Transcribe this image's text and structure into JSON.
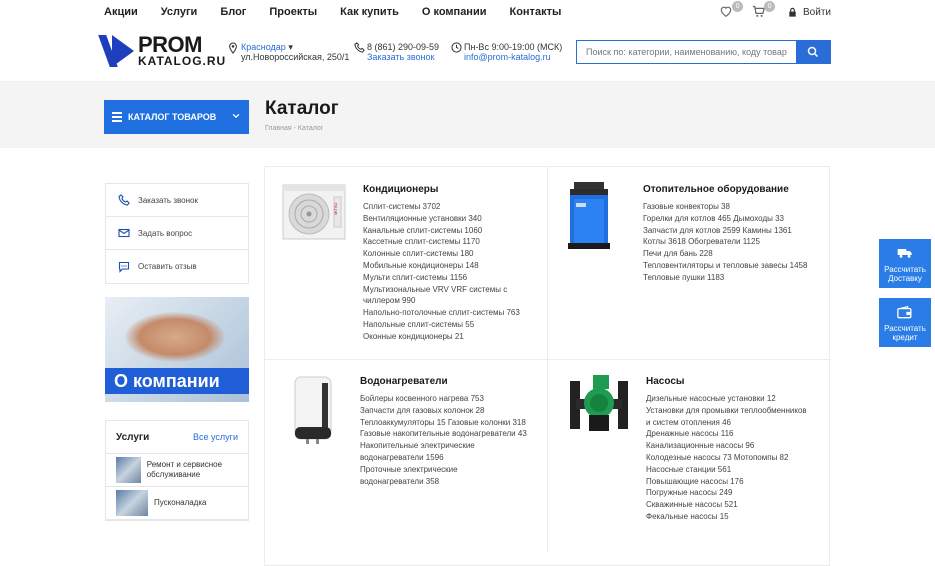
{
  "topnav": {
    "links": [
      "Акции",
      "Услуги",
      "Блог",
      "Проекты",
      "Как купить",
      "О компании",
      "Контакты"
    ],
    "favorites_count": "0",
    "cart_count": "0",
    "login_label": "Войти"
  },
  "header": {
    "logo_line1": "PROM",
    "logo_line2": "KATALOG.RU",
    "city": "Краснодар",
    "address": "ул.Новороссийская, 250/1",
    "phone": "8 (861) 290-09-59",
    "callback_label": "Заказать звонок",
    "hours": "Пн-Вс 9:00-19:00 (МСК)",
    "email": "info@prom-katalog.ru",
    "search_placeholder": "Поиск по: категории, наименованию, коду товара"
  },
  "catalog_button": "КАТАЛОГ ТОВАРОВ",
  "page_title": "Каталог",
  "breadcrumb": {
    "home": "Главная",
    "sep": "-",
    "current": "Каталог"
  },
  "sidebar": {
    "actions": [
      "Заказать звонок",
      "Задать вопрос",
      "Оставить отзыв"
    ],
    "promo_caption": "О компании",
    "services_title": "Услуги",
    "services_all": "Все услуги",
    "services": [
      "Ремонт и сервисное обслуживание",
      "Пусконаладка"
    ]
  },
  "side_ctas": [
    "Рассчитать Доставку",
    "Рассчитать кредит"
  ],
  "categories": [
    {
      "title": "Кондиционеры",
      "items": [
        "Сплит-системы 3702",
        "Вентиляционные установки 340",
        "Канальные сплит-системы 1060",
        "Кассетные сплит-системы 1170",
        "Колонные сплит-системы 180",
        "Мобильные кондиционеры 148",
        "Мульти сплит-системы 1156",
        "Мультизональные VRV VRF системы с",
        "чиллером 990",
        "Напольно-потолочные сплит-системы 763",
        "Напольные сплит-системы 55",
        "Оконные кондиционеры 21"
      ]
    },
    {
      "title": "Отопительное оборудование",
      "items": [
        "Газовые конвекторы 38",
        "Горелки для котлов 465   Дымоходы 33",
        "Запчасти для котлов 2599   Камины 1361",
        "Котлы 3618   Обогреватели 1125",
        "Печи для бань 228",
        "Тепловентиляторы и тепловые завесы 1458",
        "Тепловые пушки 1183"
      ]
    },
    {
      "title": "Водонагреватели",
      "items": [
        "Бойлеры косвенного нагрева 753",
        "Запчасти для газовых колонок 28",
        "Теплоаккумуляторы 15   Газовые колонки 318",
        "Газовые накопительные водонагреватели 43",
        "Накопительные электрические",
        "водонагреватели 1596",
        "Проточные электрические",
        "водонагреватели 358"
      ]
    },
    {
      "title": "Насосы",
      "items": [
        "Дизельные насосные установки 12",
        "Установки для промывки теплообменников",
        "и систем отопления 46",
        "Дренажные насосы 116",
        "Канализационные насосы 96",
        "Колодезные насосы 73   Мотопомпы 82",
        "Насосные станции 561",
        "Повышающие насосы 176",
        "Погружные насосы 249",
        "Скважинные насосы 521",
        "Фекальные насосы 15"
      ]
    }
  ],
  "colors": {
    "accent": "#1f6fe0",
    "link": "#2a6dd6",
    "logo": "#1e3fbd"
  }
}
